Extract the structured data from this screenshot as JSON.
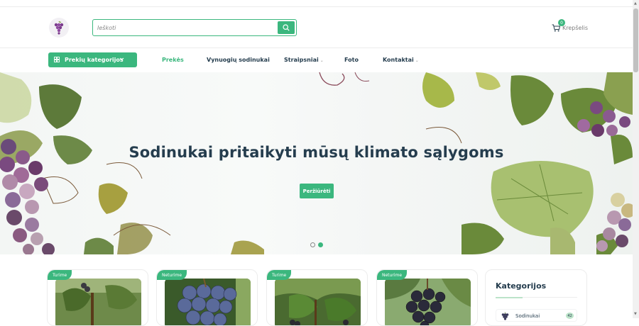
{
  "header": {
    "search": {
      "placeholder": "Ieškoti",
      "value": ""
    },
    "cart": {
      "count": "0",
      "label": "Krepšelis"
    }
  },
  "nav": {
    "categories_button": "Prekių kategorijos",
    "items": [
      {
        "label": "Prekės",
        "active": true,
        "has_dropdown": false
      },
      {
        "label": "Vynuogių sodinukai",
        "active": false,
        "has_dropdown": false
      },
      {
        "label": "Straipsniai",
        "active": false,
        "has_dropdown": true
      },
      {
        "label": "Foto",
        "active": false,
        "has_dropdown": false
      },
      {
        "label": "Kontaktai",
        "active": false,
        "has_dropdown": true
      }
    ]
  },
  "hero": {
    "title": "Sodinukai pritaikyti mūsų klimato sąlygoms",
    "button": "Peržiūrėti",
    "slides_total": 2,
    "active_slide": 2
  },
  "products": [
    {
      "badge": "Turime",
      "image": "grapes-green-white"
    },
    {
      "badge": "Neturime",
      "image": "grapes-blue"
    },
    {
      "badge": "Turime",
      "image": "grapes-vine-leaves"
    },
    {
      "badge": "Neturime",
      "image": "grapes-dark"
    }
  ],
  "sidebar": {
    "title": "Kategorijos",
    "items": [
      {
        "label": "Sodinukai",
        "count": "42"
      }
    ]
  },
  "colors": {
    "accent": "#3bb77e",
    "heading": "#253d4e",
    "accent_light": "#bce3c9"
  }
}
